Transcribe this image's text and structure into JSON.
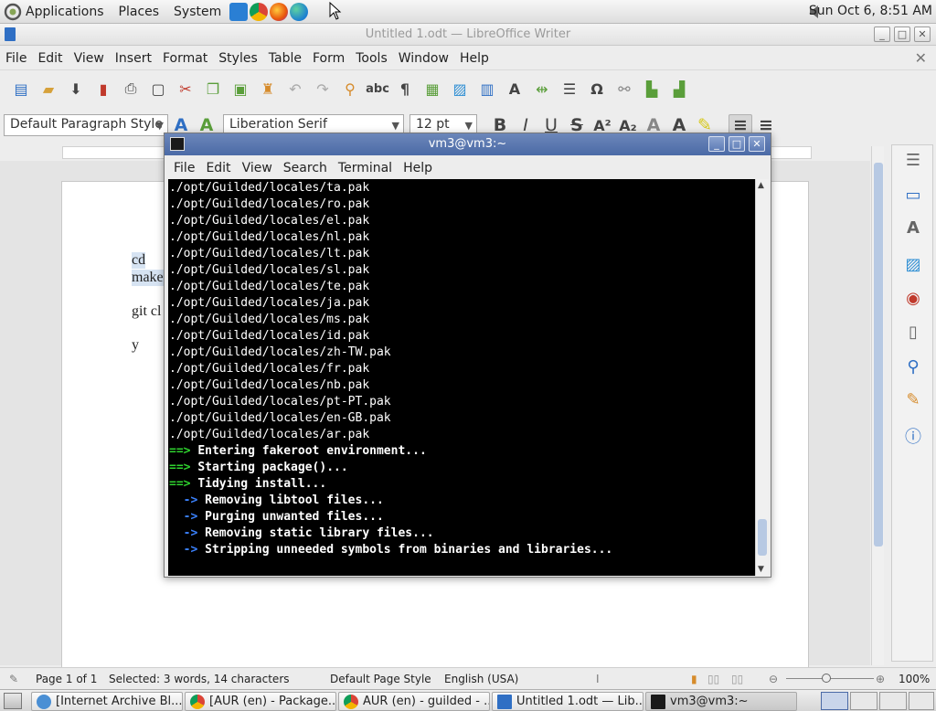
{
  "top_panel": {
    "menus": [
      "Applications",
      "Places",
      "System"
    ],
    "clock": "Sun Oct  6,  8:51 AM",
    "launchers": [
      "vscode-icon",
      "chrome-icon",
      "firefox-icon",
      "edge-dev-icon"
    ]
  },
  "writer": {
    "title": "Untitled 1.odt — LibreOffice Writer",
    "menus": [
      "File",
      "Edit",
      "View",
      "Insert",
      "Format",
      "Styles",
      "Table",
      "Form",
      "Tools",
      "Window",
      "Help"
    ],
    "paragraph_style": "Default Paragraph Style",
    "font_name": "Liberation Serif",
    "font_size": "12 pt",
    "doc_lines": [
      "cd",
      "make",
      "git cl",
      "y"
    ],
    "status": {
      "page": "Page 1 of 1",
      "selection": "Selected: 3 words, 14 characters",
      "page_style": "Default Page Style",
      "language": "English (USA)",
      "zoom": "100%"
    }
  },
  "terminal": {
    "title": "vm3@vm3:~",
    "menus": [
      "File",
      "Edit",
      "View",
      "Search",
      "Terminal",
      "Help"
    ],
    "paths": [
      "./opt/Guilded/locales/ta.pak",
      "./opt/Guilded/locales/ro.pak",
      "./opt/Guilded/locales/el.pak",
      "./opt/Guilded/locales/nl.pak",
      "./opt/Guilded/locales/lt.pak",
      "./opt/Guilded/locales/sl.pak",
      "./opt/Guilded/locales/te.pak",
      "./opt/Guilded/locales/ja.pak",
      "./opt/Guilded/locales/ms.pak",
      "./opt/Guilded/locales/id.pak",
      "./opt/Guilded/locales/zh-TW.pak",
      "./opt/Guilded/locales/fr.pak",
      "./opt/Guilded/locales/nb.pak",
      "./opt/Guilded/locales/pt-PT.pak",
      "./opt/Guilded/locales/en-GB.pak",
      "./opt/Guilded/locales/ar.pak"
    ],
    "steps": [
      {
        "marker": "==>",
        "text": "Entering fakeroot environment..."
      },
      {
        "marker": "==>",
        "text": "Starting package()..."
      },
      {
        "marker": "==>",
        "text": "Tidying install..."
      }
    ],
    "substeps": [
      {
        "marker": "  ->",
        "text": "Removing libtool files..."
      },
      {
        "marker": "  ->",
        "text": "Purging unwanted files..."
      },
      {
        "marker": "  ->",
        "text": "Removing static library files..."
      },
      {
        "marker": "  ->",
        "text": "Stripping unneeded symbols from binaries and libraries..."
      }
    ]
  },
  "taskbar": {
    "tasks": [
      "[Internet Archive Bl...",
      "[AUR (en) - Package...",
      "AUR (en) - guilded - ...",
      "Untitled 1.odt — Lib...",
      "vm3@vm3:~"
    ]
  },
  "colors": {
    "terminal_bg": "#000000",
    "arrow_green": "#2fd42f",
    "arrow_blue": "#3b82ff",
    "title_blue": "#4b6aa6"
  }
}
